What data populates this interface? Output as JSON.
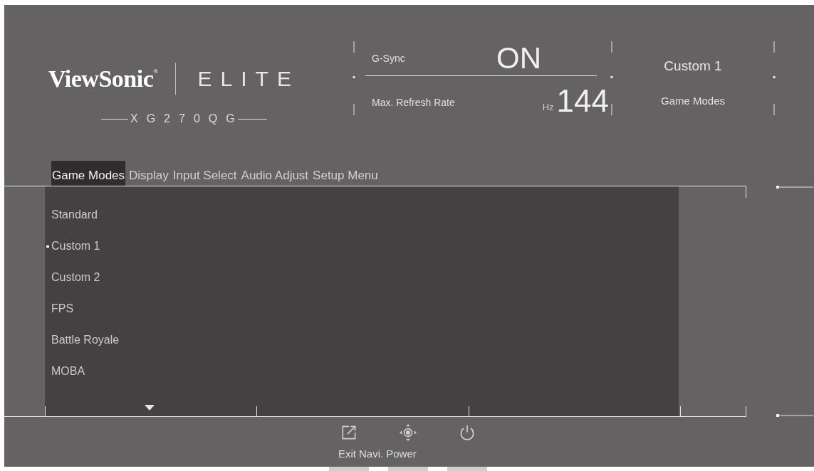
{
  "brand": {
    "logo": "ViewSonic$^{®}$",
    "series": "ELITE",
    "model": "XG270QG"
  },
  "status": {
    "g_sync": {
      "label": "G-Sync",
      "value": "ON"
    },
    "max_refresh_rate": {
      "label": "Max. Refresh Rate",
      "unit": "Hz",
      "value": "144"
    },
    "game_mode": {
      "value": "Custom 1",
      "label": "Game Modes"
    }
  },
  "tabs": [
    {
      "label": "Game Modes",
      "selected": true
    },
    {
      "label": "Display",
      "selected": false
    },
    {
      "label": "Input Select",
      "selected": false
    },
    {
      "label": "Audio Adjust",
      "selected": false
    },
    {
      "label": "Setup Menu",
      "selected": false
    }
  ],
  "modes": [
    {
      "label": "Standard",
      "selected": false
    },
    {
      "label": "Custom 1",
      "selected": true
    },
    {
      "label": "Custom 2",
      "selected": false
    },
    {
      "label": "FPS",
      "selected": false
    },
    {
      "label": "Battle Royale",
      "selected": false
    },
    {
      "label": "MOBA",
      "selected": false
    }
  ],
  "keys": [
    {
      "kind": "exit",
      "label": "Exit"
    },
    {
      "kind": "navigate",
      "label": "Navi."
    },
    {
      "kind": "power",
      "label": "Power"
    }
  ]
}
